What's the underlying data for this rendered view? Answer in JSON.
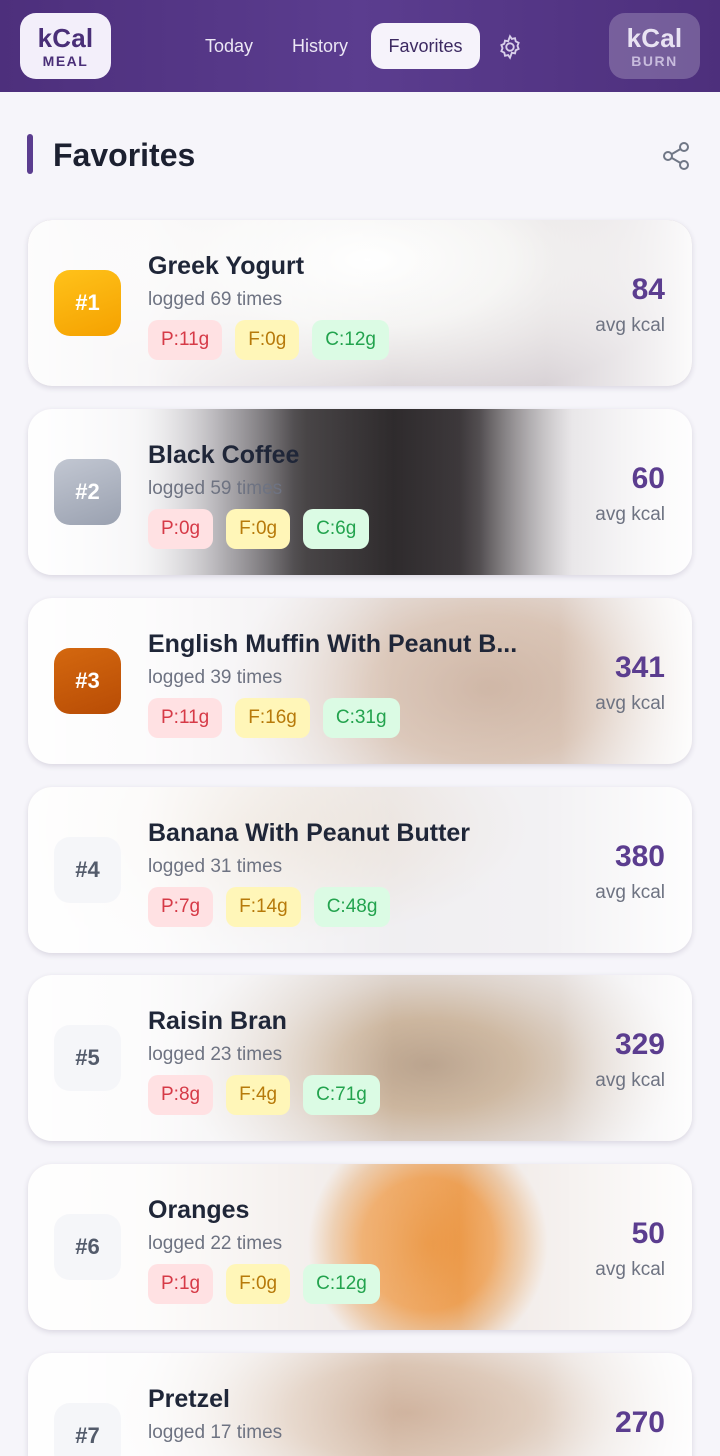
{
  "header": {
    "meal_logo": {
      "big": "kCal",
      "small": "MEAL"
    },
    "burn_logo": {
      "big": "kCal",
      "small": "BURN"
    },
    "tabs": [
      {
        "label": "Today"
      },
      {
        "label": "History"
      },
      {
        "label": "Favorites",
        "active": true
      }
    ],
    "settings_icon": "gear-icon",
    "colors": {
      "bar": "#4d2f7c",
      "accent": "#5b3d8f"
    }
  },
  "page": {
    "title": "Favorites",
    "share_icon": "share-icon"
  },
  "favorites": [
    {
      "rank": "#1",
      "name": "Greek Yogurt",
      "logged": "logged 69 times",
      "protein": "P:11g",
      "fat": "F:0g",
      "carbs": "C:12g",
      "kcal": "84",
      "kcal_label": "avg kcal",
      "badge": "gold"
    },
    {
      "rank": "#2",
      "name": "Black Coffee",
      "logged": "logged 59 times",
      "protein": "P:0g",
      "fat": "F:0g",
      "carbs": "C:6g",
      "kcal": "60",
      "kcal_label": "avg kcal",
      "badge": "silver"
    },
    {
      "rank": "#3",
      "name": "English Muffin With Peanut B...",
      "logged": "logged 39 times",
      "protein": "P:11g",
      "fat": "F:16g",
      "carbs": "C:31g",
      "kcal": "341",
      "kcal_label": "avg kcal",
      "badge": "bronze"
    },
    {
      "rank": "#4",
      "name": "Banana With Peanut Butter",
      "logged": "logged 31 times",
      "protein": "P:7g",
      "fat": "F:14g",
      "carbs": "C:48g",
      "kcal": "380",
      "kcal_label": "avg kcal",
      "badge": "plain"
    },
    {
      "rank": "#5",
      "name": "Raisin Bran",
      "logged": "logged 23 times",
      "protein": "P:8g",
      "fat": "F:4g",
      "carbs": "C:71g",
      "kcal": "329",
      "kcal_label": "avg kcal",
      "badge": "plain"
    },
    {
      "rank": "#6",
      "name": "Oranges",
      "logged": "logged 22 times",
      "protein": "P:1g",
      "fat": "F:0g",
      "carbs": "C:12g",
      "kcal": "50",
      "kcal_label": "avg kcal",
      "badge": "plain"
    },
    {
      "rank": "#7",
      "name": "Pretzel",
      "logged": "logged 17 times",
      "kcal": "270",
      "badge": "plain"
    }
  ]
}
